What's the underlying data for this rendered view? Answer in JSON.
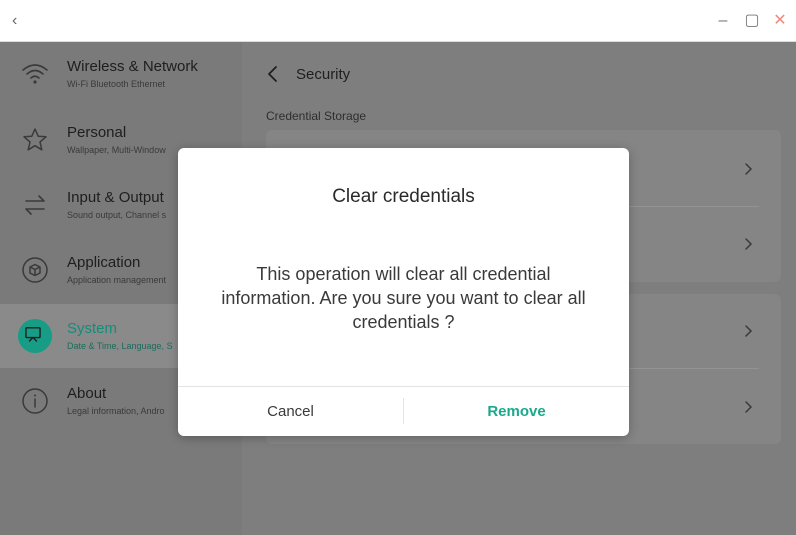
{
  "window": {
    "back_glyph": "‹",
    "minimize_glyph": "–",
    "maximize_glyph": "▢",
    "close_glyph": "✕",
    "close_color": "#f08a7e"
  },
  "sidebar": {
    "items": [
      {
        "title": "Wireless & Network",
        "subtitle": "Wi-Fi Bluetooth Ethernet",
        "icon": "wifi-icon"
      },
      {
        "title": "Personal",
        "subtitle": "Wallpaper, Multi-Window",
        "icon": "star-icon"
      },
      {
        "title": "Input & Output",
        "subtitle": "Sound output, Channel s",
        "icon": "swap-arrows-icon"
      },
      {
        "title": "Application",
        "subtitle": "Application management",
        "icon": "cube-icon"
      },
      {
        "title": "System",
        "subtitle": "Date & Time, Language, S",
        "icon": "monitor-icon",
        "active": true
      },
      {
        "title": "About",
        "subtitle": "Legal information, Andro",
        "icon": "info-icon"
      }
    ],
    "accent": "#179c86"
  },
  "main": {
    "title": "Security",
    "section_label": "Credential Storage"
  },
  "dialog": {
    "title": "Clear credentials",
    "message": "This operation will clear all credential information. Are you sure you want to clear all credentials ?",
    "cancel_label": "Cancel",
    "remove_label": "Remove",
    "remove_color": "#1aa98c"
  }
}
